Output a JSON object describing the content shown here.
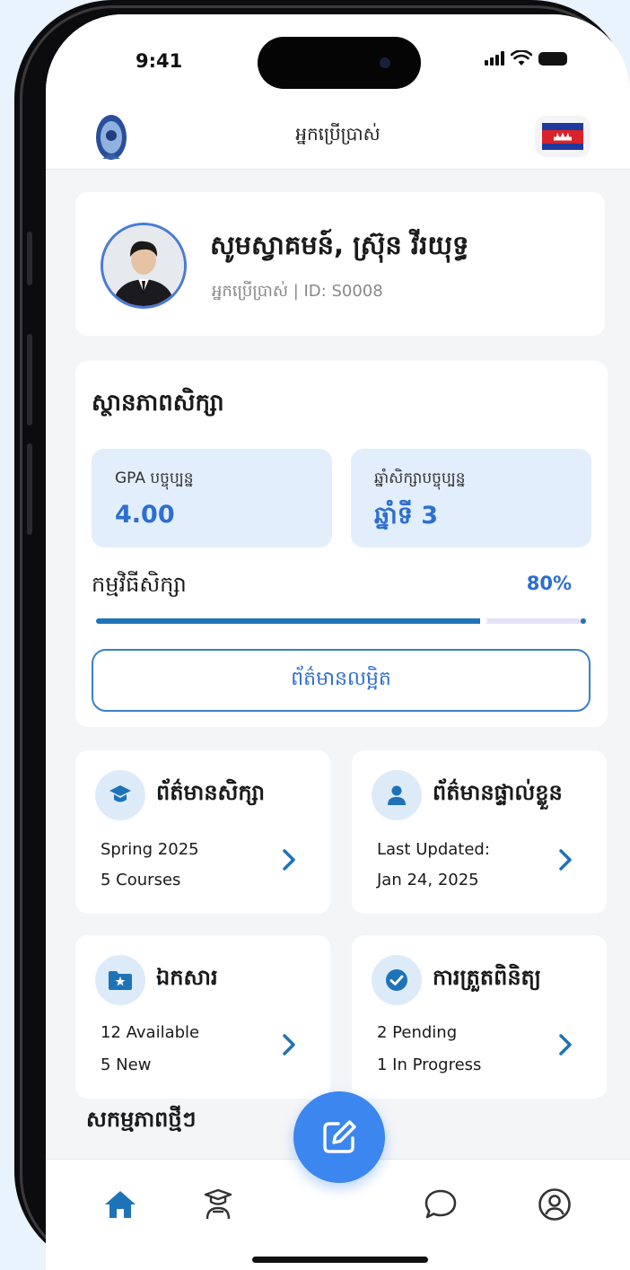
{
  "status_bar": {
    "time": "9:41"
  },
  "header": {
    "title": "អ្នកប្រើប្រាស់"
  },
  "profile": {
    "greeting": "សូមស្វាគមន៍, ស្រ៊ុន វីរយុទ្ធ",
    "subtitle": "អ្នកប្រើប្រាស់ | ID: S0008"
  },
  "academic_status": {
    "title": "ស្ថានភាពសិក្សា",
    "gpa_label": "GPA បច្ចុប្បន្ន",
    "gpa_value": "4.00",
    "year_label": "ឆ្នាំសិក្សាបច្ចុប្បន្ន",
    "year_value": "ឆ្នាំទី 3",
    "progress_label": "កម្មវិធីសិក្សា",
    "progress_percent": "80%",
    "progress_fraction": 0.8,
    "detail_button": "ព័ត៌មានលម្អិត"
  },
  "menu": [
    {
      "title": "ព័ត៌មានសិក្សា",
      "line1": "Spring 2025",
      "line2": "5 Courses",
      "icon": "graduation-cap-icon"
    },
    {
      "title": "ព័ត៌មានផ្ទាល់ខ្លួន",
      "line1": "Last Updated:",
      "line2": "Jan 24, 2025",
      "icon": "person-icon"
    },
    {
      "title": "ឯកសារ",
      "line1": "12 Available",
      "line2": "5 New",
      "icon": "folder-star-icon"
    },
    {
      "title": "ការត្រួតពិនិត្យ",
      "line1": "2 Pending",
      "line2": "1 In Progress",
      "icon": "check-circle-icon"
    }
  ],
  "recent": {
    "title": "សកម្មភាពថ្មីៗ"
  },
  "nav": {
    "items": [
      "home-icon",
      "student-icon",
      "chat-icon",
      "profile-icon"
    ],
    "fab_icon": "edit-icon"
  },
  "colors": {
    "accent": "#2c6fd1",
    "fab": "#3c86f0",
    "progress": "#1e73b8",
    "stat_bg": "#e2eefb"
  }
}
